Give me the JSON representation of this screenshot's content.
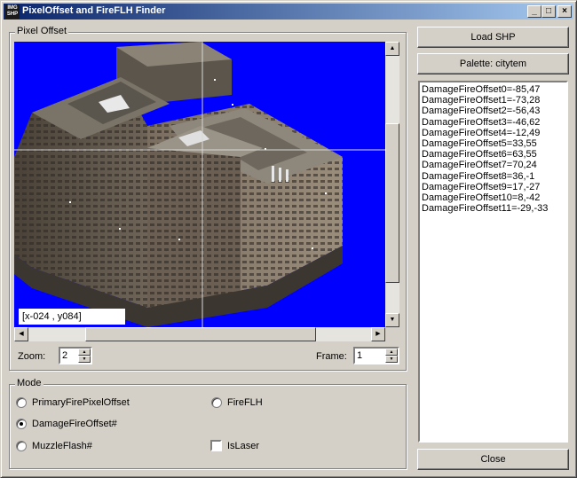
{
  "window": {
    "title": "PixelOffset and FireFLH Finder",
    "icon_text": "IMG SHP",
    "controls": {
      "minimize": "_",
      "maximize": "□",
      "close": "×"
    }
  },
  "pixel_offset_group": {
    "label": "Pixel Offset",
    "coordinate": "[x-024 , y084]",
    "zoom_label": "Zoom:",
    "zoom_value": "2",
    "frame_label": "Frame:",
    "frame_value": "1"
  },
  "mode_group": {
    "label": "Mode",
    "options": [
      {
        "label": "PrimaryFirePixelOffset",
        "checked": false
      },
      {
        "label": "DamageFireOffset#",
        "checked": true
      },
      {
        "label": "MuzzleFlash#",
        "checked": false
      },
      {
        "label": "FireFLH",
        "checked": false
      }
    ],
    "islaser_label": "IsLaser",
    "islaser_checked": false
  },
  "buttons": {
    "load": "Load SHP",
    "palette": "Palette: citytem",
    "close": "Close"
  },
  "offsets_list": [
    "DamageFireOffset0=-85,47",
    "DamageFireOffset1=-73,28",
    "DamageFireOffset2=-56,43",
    "DamageFireOffset3=-46,62",
    "DamageFireOffset4=-12,49",
    "DamageFireOffset5=33,55",
    "DamageFireOffset6=63,55",
    "DamageFireOffset7=70,24",
    "DamageFireOffset8=36,-1",
    "DamageFireOffset9=17,-27",
    "DamageFireOffset10=8,-42",
    "DamageFireOffset11=-29,-33"
  ],
  "colors": {
    "viewport_bg": "#0000ff",
    "titlebar": "#0a246a",
    "face": "#d4d0c8"
  }
}
